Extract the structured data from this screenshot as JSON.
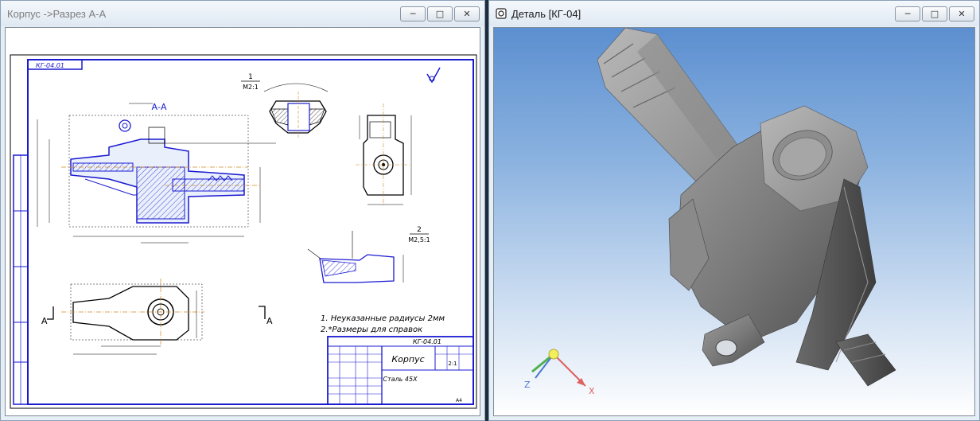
{
  "windows": {
    "drawing": {
      "title": "Корпус ->Разрез А-А",
      "drawing": {
        "top_code": "КГ-04.01",
        "view_label_aa": "А-А",
        "section_1_num": "1",
        "section_1_scale": "М2:1",
        "section_2_num": "2",
        "section_2_scale": "М2,5:1",
        "view_arrow_left": "А",
        "view_arrow_right": "А",
        "notes": [
          "1. Неуказанные радиусы 2мм",
          "2.*Размеры для справок"
        ],
        "title_block": {
          "code": "КГ-04.01",
          "name": "Корпус",
          "material": "Сталь 45Х",
          "scale": "2:1",
          "format": "А4"
        }
      }
    },
    "model": {
      "title": "Деталь [КГ-04]",
      "axis_x_label": "X",
      "axis_z_label": "Z"
    }
  },
  "window_controls": {
    "minimize": "─",
    "maximize": "□",
    "close": "✕"
  },
  "colors": {
    "frame_blue": "#1a1ad0",
    "axis_x": "#e06060",
    "axis_y": "#50b050",
    "axis_z": "#4a78d0"
  }
}
